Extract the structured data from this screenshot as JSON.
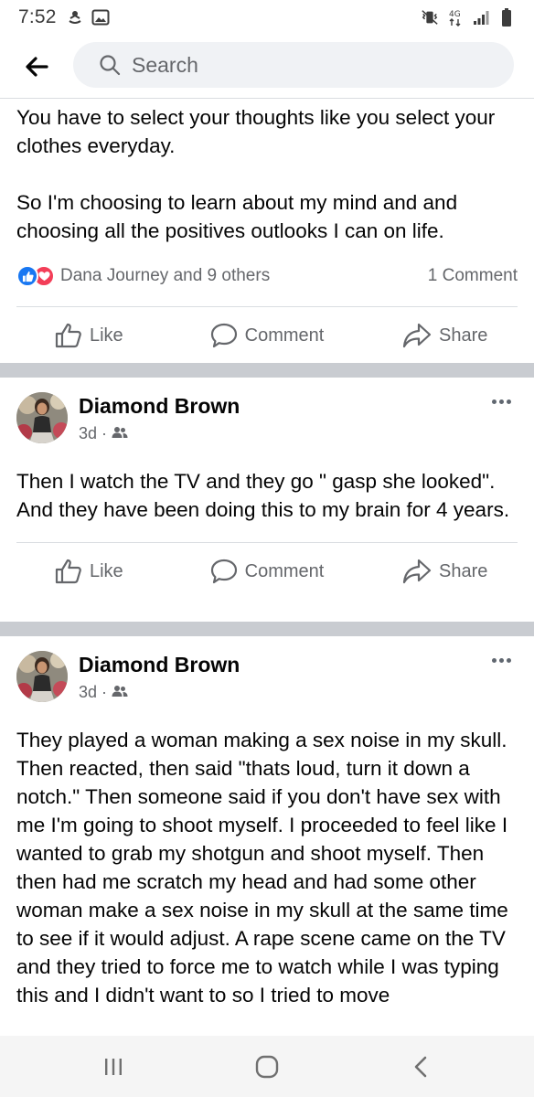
{
  "status_bar": {
    "time": "7:52",
    "left_icons": [
      "bluetooth-rhythm-icon",
      "image-icon"
    ],
    "right_icons": [
      "mute-vibrate-icon",
      "network-4g-icon",
      "signal-icon",
      "battery-icon"
    ]
  },
  "header": {
    "search_placeholder": "Search"
  },
  "posts": [
    {
      "paragraphs": [
        "You have to select your thoughts like you select your clothes everyday.",
        "So I'm choosing to learn about my mind and and choosing all the positives outlooks I can on life."
      ],
      "reactions_text": "Dana Journey and 9 others",
      "comments_text": "1 Comment",
      "actions": {
        "like": "Like",
        "comment": "Comment",
        "share": "Share"
      }
    },
    {
      "author": "Diamond Brown",
      "time": "3d",
      "meta_separator": "·",
      "text": "Then I watch the TV and they go \" gasp she looked\". And they have been doing this to my brain for 4 years.",
      "actions": {
        "like": "Like",
        "comment": "Comment",
        "share": "Share"
      }
    },
    {
      "author": "Diamond Brown",
      "time": "3d",
      "meta_separator": "·",
      "text": "They played a woman making a sex noise in my skull. Then reacted, then said \"thats loud, turn it down a notch.\" Then someone said if you don't have sex with me I'm going to shoot myself. I proceeded to feel like I wanted to grab my shotgun and shoot myself. Then then had me scratch my head and had some other woman make a sex noise in my skull at the same time to see if it would adjust. A rape scene came on the TV and they tried to force me to watch while I was typing this and I didn't want to so I tried to move"
    }
  ],
  "colors": {
    "like_blue": "#1877f2",
    "love_red": "#f33e58",
    "secondary_text": "#65676b",
    "separator": "#c9ccd1"
  }
}
